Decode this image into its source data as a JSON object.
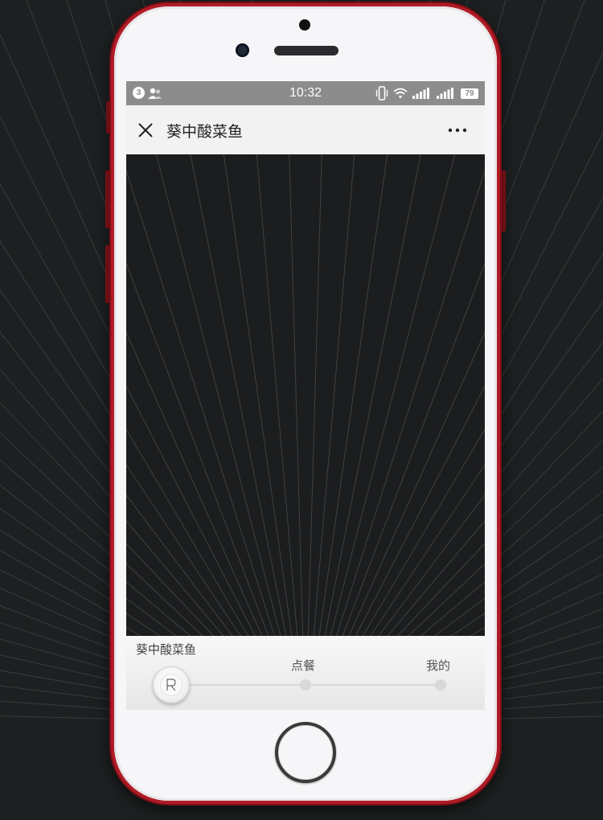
{
  "status_bar": {
    "notification_count": "3",
    "time": "10:32",
    "battery_level": "79",
    "icons": [
      "contacts-icon",
      "vibrate-icon",
      "wifi-icon",
      "signal-icon",
      "signal-icon",
      "battery-icon"
    ]
  },
  "nav": {
    "title": "葵中酸菜鱼",
    "close_icon": "close-icon",
    "more_icon": "more-icon"
  },
  "tabbar": {
    "brand": "葵中酸菜鱼",
    "tabs": [
      {
        "label": "点餐"
      },
      {
        "label": "我的"
      }
    ],
    "home_icon": "R"
  },
  "colors": {
    "phone_frame": "#b01c26",
    "status_bar": "#8c8c8c",
    "nav_bar": "#f2f2f2",
    "content_bg": "#1c1d1e"
  }
}
